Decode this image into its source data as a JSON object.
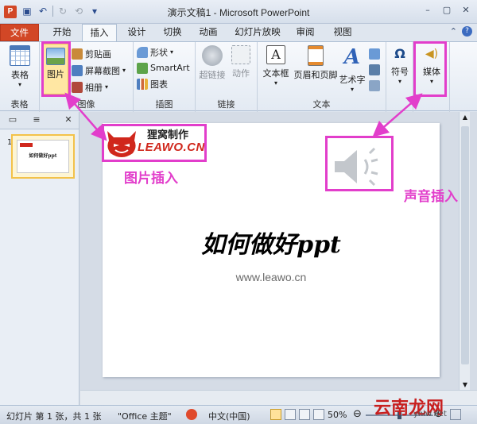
{
  "window": {
    "title": "演示文稿1 - Microsoft PowerPoint",
    "app_icon": "P"
  },
  "tabs": [
    "文件",
    "开始",
    "插入",
    "设计",
    "切换",
    "动画",
    "幻灯片放映",
    "审阅",
    "视图"
  ],
  "ribbon": {
    "groups": {
      "table": {
        "label": "表格",
        "button": "表格"
      },
      "images": {
        "label": "图像",
        "picture": "图片",
        "clipart": "剪贴画",
        "screenshot": "屏幕截图",
        "album": "相册"
      },
      "illustrations": {
        "label": "插图",
        "shapes": "形状",
        "smartart": "SmartArt",
        "chart": "图表"
      },
      "links": {
        "label": "链接",
        "hyperlink": "超链接",
        "action": "动作"
      },
      "text": {
        "label": "文本",
        "textbox": "文本框",
        "header_footer": "页眉和页脚",
        "wordart": "艺术字"
      },
      "symbols": {
        "button": "符号"
      },
      "media": {
        "button": "媒体"
      }
    }
  },
  "thumbnails": {
    "number": "1",
    "preview_text": "如何做好ppt"
  },
  "slide": {
    "logo_cn": "狸窝制作",
    "logo_en": "LEAWO.CN",
    "title": "如何做好ppt",
    "url": "www.leawo.cn"
  },
  "callouts": {
    "picture": "图片插入",
    "sound": "声音插入"
  },
  "status": {
    "slide_info": "幻灯片 第 1 张，共 1 张",
    "theme": "\"Office 主题\"",
    "language": "中文(中国)",
    "zoom": "50%"
  },
  "watermark": {
    "brand": "云南龙网",
    "sub": "ynlw.net"
  },
  "colors": {
    "highlight": "#e23ecb",
    "file_tab": "#d24726",
    "logo_red": "#d0271c"
  }
}
